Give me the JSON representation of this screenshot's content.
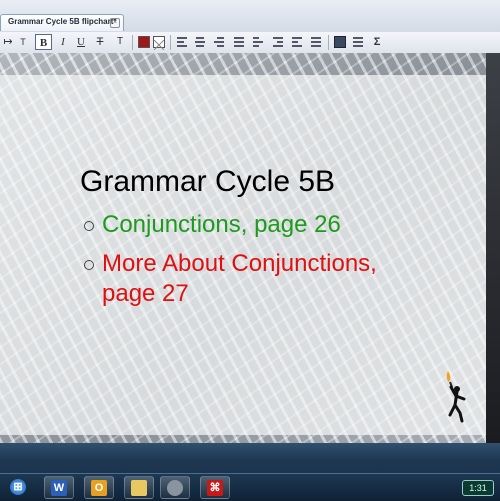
{
  "tab": {
    "title": "Grammar Cycle 5B flipchart*",
    "close_glyph": "×"
  },
  "toolbar": {
    "bold": "B",
    "italic": "I",
    "underline": "U",
    "strike": "T",
    "subscript": "T",
    "sigma": "Σ",
    "text_color": "#a01818"
  },
  "slide": {
    "title": "Grammar Cycle 5B",
    "bullets": [
      {
        "text": "Conjunctions, page 26",
        "color": "#1e9a1e"
      },
      {
        "lines": [
          "More About Conjunctions,",
          "page 27"
        ],
        "color": "#e01010"
      }
    ]
  },
  "taskbar": {
    "apps": [
      "windows-start-icon",
      "word-icon",
      "outlook-icon",
      "explorer-icon",
      "graphics-icon",
      "pdf-icon"
    ],
    "clock": "1:31"
  }
}
